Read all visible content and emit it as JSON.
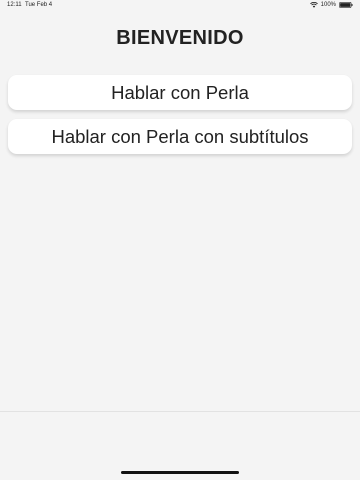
{
  "status_bar": {
    "time": "12:11",
    "date": "Tue Feb 4",
    "battery": "100%",
    "wifi_icon": "wifi-icon",
    "battery_icon": "battery-icon"
  },
  "screen": {
    "title": "BIENVENIDO",
    "buttons": [
      {
        "label": "Hablar con Perla"
      },
      {
        "label": "Hablar con Perla con subtítulos"
      }
    ]
  },
  "colors": {
    "background": "#f4f4f4",
    "button_background": "#ffffff",
    "text": "#222222",
    "home_indicator": "#111111"
  }
}
